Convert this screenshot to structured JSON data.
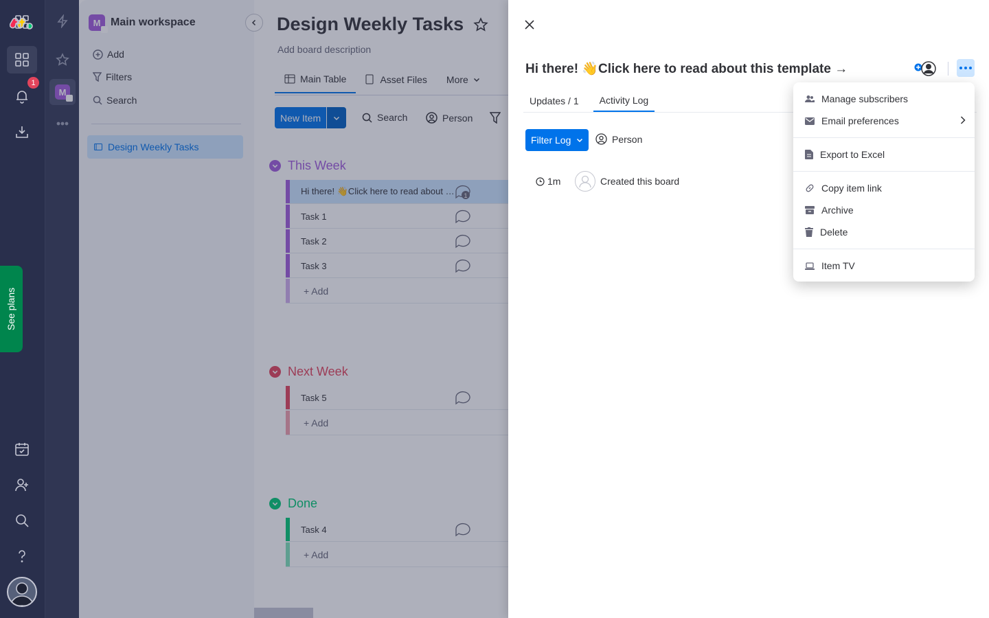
{
  "rail": {
    "notification_count": "1",
    "icons": [
      "monday-logo-icon",
      "lightning-icon",
      "apps-grid-icon",
      "star-icon",
      "bell-icon",
      "download-icon",
      "more-dots-icon",
      "calendar-check-icon",
      "invite-user-icon",
      "search-icon",
      "help-icon",
      "user-avatar-icon"
    ]
  },
  "see_plans": "See plans",
  "workspace": {
    "name": "Main workspace",
    "initial": "M",
    "color": "#a25ddc",
    "actions": [
      "Add",
      "Filters",
      "Search"
    ],
    "boards": [
      "Design Weekly Tasks"
    ]
  },
  "board": {
    "title": "Design Weekly Tasks",
    "description": "Add board description",
    "tabs": [
      "Main Table",
      "Asset Files",
      "More"
    ],
    "new_item": "New Item",
    "toolbar": [
      "Search",
      "Person"
    ],
    "groups": [
      {
        "title": "This Week",
        "color": "#a25ddc",
        "rows": [
          "Hi there! 👋Click here to read about this template →",
          "Task 1",
          "Task 2",
          "Task 3"
        ],
        "update_badge": "1",
        "add_label": "+ Add"
      },
      {
        "title": "Next Week",
        "color": "#e2445c",
        "rows": [
          "Task 5"
        ],
        "add_label": "+ Add"
      },
      {
        "title": "Done",
        "color": "#00c875",
        "rows": [
          "Task 4"
        ],
        "add_label": "+ Add"
      }
    ]
  },
  "item_panel": {
    "title": "Hi there! 👋Click here to read about this template →",
    "tabs": [
      "Updates / 1",
      "Activity Log"
    ],
    "active_tab": "Activity Log",
    "filter_log": "Filter Log",
    "person_filter": "Person",
    "log": [
      {
        "time": "1m",
        "text": "Created this board"
      }
    ]
  },
  "menu": {
    "items": [
      {
        "label": "Manage subscribers",
        "icon": "people-icon"
      },
      {
        "label": "Email preferences",
        "icon": "envelope-icon",
        "submenu": true
      },
      {
        "label": "Export to Excel",
        "icon": "document-icon"
      },
      {
        "label": "Copy item link",
        "icon": "link-icon"
      },
      {
        "label": "Archive",
        "icon": "archive-box-icon"
      },
      {
        "label": "Delete",
        "icon": "trash-icon"
      },
      {
        "label": "Item TV",
        "icon": "laptop-icon"
      }
    ]
  },
  "colors": {
    "primary": "#0073ea",
    "rail": "#292f4c",
    "selected": "#cce5ff"
  }
}
